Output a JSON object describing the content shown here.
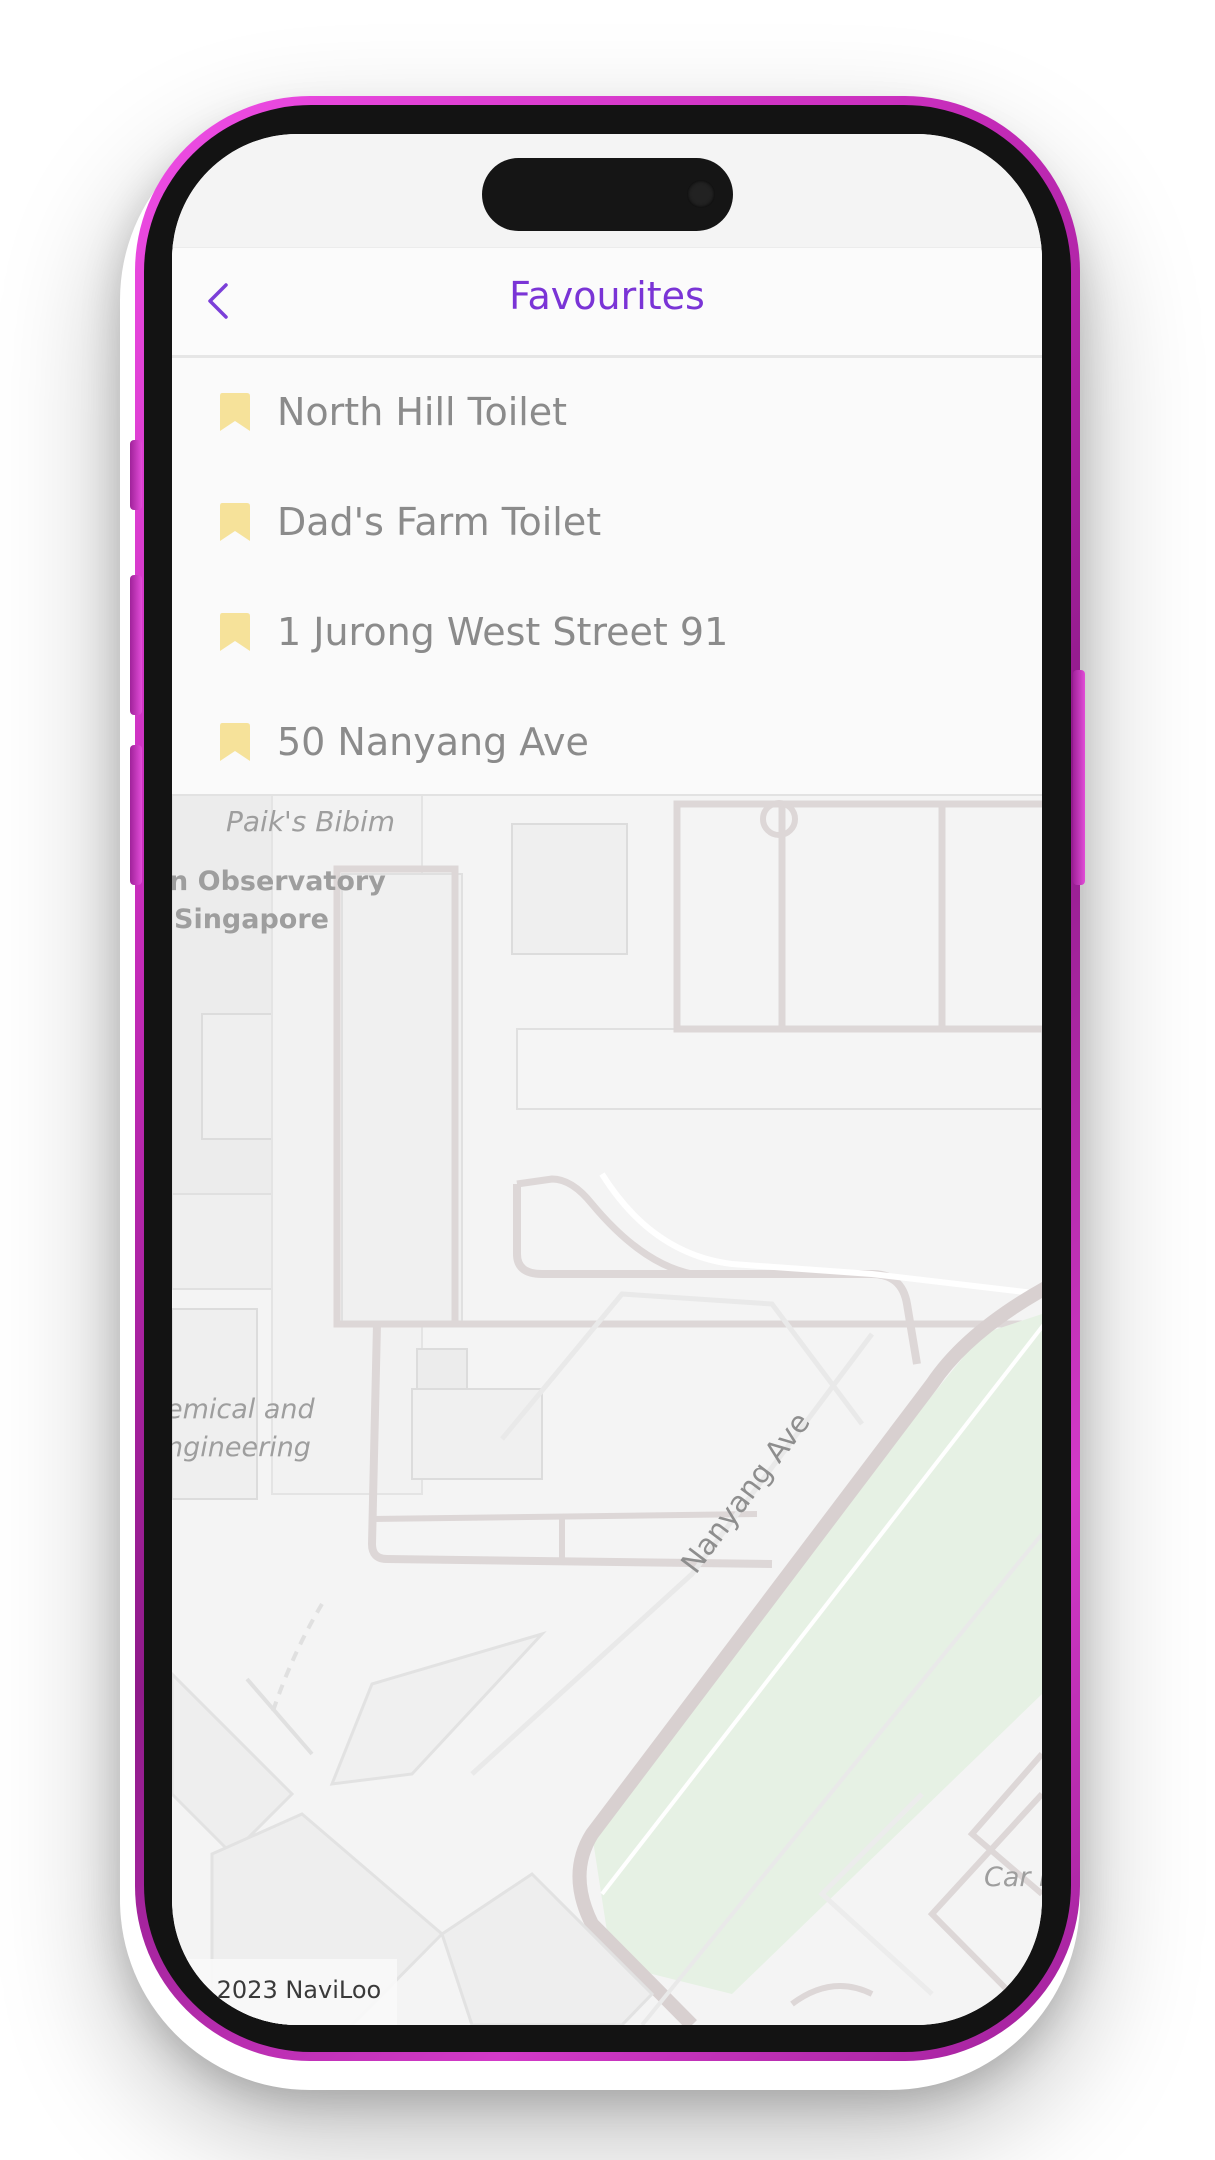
{
  "header": {
    "title": "Favourites",
    "back_icon": "chevron-left-icon"
  },
  "favourites": [
    {
      "label": "North Hill Toilet",
      "icon": "bookmark-icon"
    },
    {
      "label": "Dad's Farm Toilet",
      "icon": "bookmark-icon"
    },
    {
      "label": "1 Jurong West Street 91",
      "icon": "bookmark-icon"
    },
    {
      "label": "50 Nanyang Ave",
      "icon": "bookmark-icon"
    }
  ],
  "map": {
    "labels": {
      "poi_paiks": "Paik's Bibim",
      "building_observatory_1": "n Observatory",
      "building_observatory_2": "Singapore",
      "building_chem_1": "emical and",
      "building_chem_2": "ngineering",
      "street_nanyang": "Nanyang Ave",
      "poi_carpark": "Car P"
    },
    "attribution": "© 2023 NaviLoo"
  },
  "colors": {
    "accent": "#7a34d6",
    "bookmark": "#f6e29a",
    "frame": "#d33ac8",
    "park": "#e6f1e4",
    "road": "#ddd6d6"
  }
}
